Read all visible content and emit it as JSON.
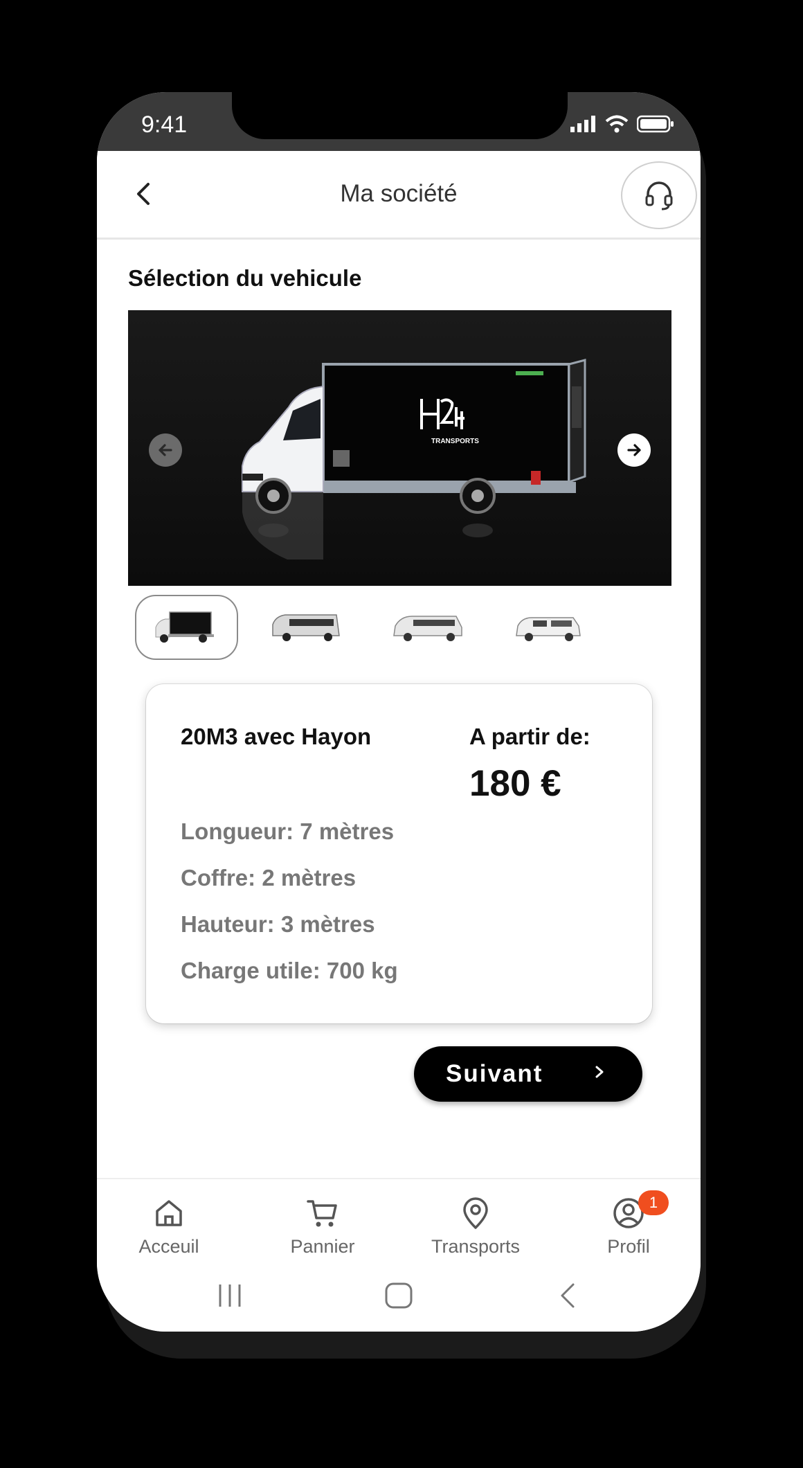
{
  "status_bar": {
    "time": "9:41",
    "icons": [
      "signal-icon",
      "wifi-icon",
      "battery-icon"
    ]
  },
  "header": {
    "title": "Ma société",
    "back_icon": "chevron-left-icon",
    "support_icon": "headset-icon"
  },
  "section": {
    "title": "Sélection du vehicule"
  },
  "carousel": {
    "main_image": "box-truck-image",
    "brand_text": "TRANSPORTS",
    "prev_icon": "arrow-left-icon",
    "next_icon": "arrow-right-icon",
    "thumbnails": [
      {
        "name": "box-truck-thumbnail",
        "selected": true
      },
      {
        "name": "van-thumbnail",
        "selected": false
      },
      {
        "name": "minivan-thumbnail",
        "selected": false
      },
      {
        "name": "small-van-thumbnail",
        "selected": false
      }
    ]
  },
  "vehicle": {
    "name": "20M3 avec Hayon",
    "price_label": "A partir de:",
    "price": "180 €",
    "specs": [
      "Longueur: 7 mètres",
      "Coffre: 2 mètres",
      "Hauteur: 3 mètres",
      "Charge utile: 700 kg"
    ]
  },
  "actions": {
    "next_label": "Suivant"
  },
  "bottom_nav": {
    "items": [
      {
        "label": "Acceuil",
        "icon": "home-icon"
      },
      {
        "label": "Pannier",
        "icon": "cart-icon"
      },
      {
        "label": "Transports",
        "icon": "location-pin-icon"
      },
      {
        "label": "Profil",
        "icon": "profile-icon",
        "badge": "1"
      }
    ]
  },
  "colors": {
    "accent": "#000000",
    "badge": "#f04e1f",
    "muted_text": "#777777"
  }
}
